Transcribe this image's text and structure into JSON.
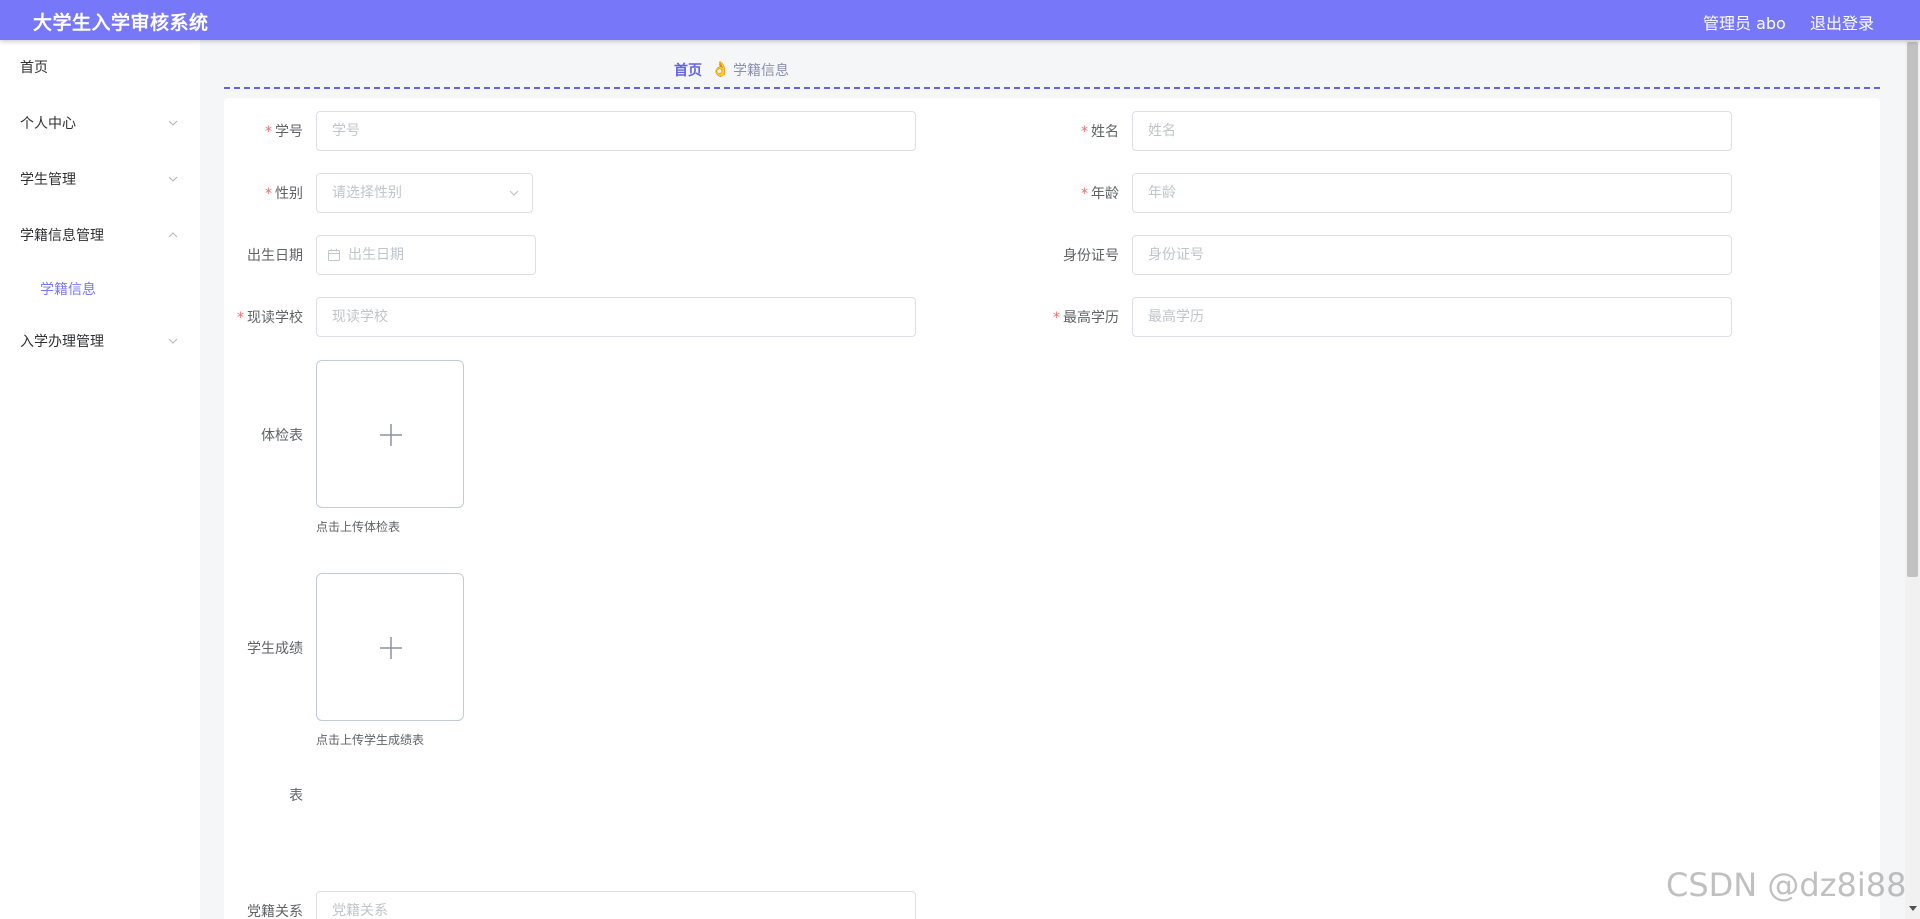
{
  "header": {
    "title": "大学生入学审核系统",
    "user": "管理员 abo",
    "logout": "退出登录"
  },
  "sidebar": {
    "items": [
      {
        "label": "首页"
      },
      {
        "label": "个人中心"
      },
      {
        "label": "学生管理"
      },
      {
        "label": "学籍信息管理",
        "children": [
          {
            "label": "学籍信息"
          }
        ]
      },
      {
        "label": "入学办理管理"
      }
    ]
  },
  "breadcrumb": {
    "home": "首页",
    "current": "学籍信息"
  },
  "form": {
    "required_mark": "*",
    "student_no": {
      "label": "学号",
      "placeholder": "学号"
    },
    "name": {
      "label": "姓名",
      "placeholder": "姓名"
    },
    "gender": {
      "label": "性别",
      "placeholder": "请选择性别"
    },
    "age": {
      "label": "年龄",
      "placeholder": "年龄"
    },
    "birth_date": {
      "label": "出生日期",
      "placeholder": "出生日期"
    },
    "id_number": {
      "label": "身份证号",
      "placeholder": "身份证号"
    },
    "school": {
      "label": "现读学校",
      "placeholder": "现读学校"
    },
    "education": {
      "label": "最高学历",
      "placeholder": "最高学历"
    },
    "health_form": {
      "label": "体检表",
      "tip": "点击上传体检表"
    },
    "grades": {
      "label_line1": "学生成绩",
      "label_line2": "表",
      "tip": "点击上传学生成绩表"
    },
    "party": {
      "label": "党籍关系",
      "placeholder": "党籍关系"
    }
  },
  "watermark": "CSDN @dz8i88",
  "colors": {
    "header": "#7777f9",
    "accent": "#6364e3",
    "required": "#f56c6c"
  }
}
